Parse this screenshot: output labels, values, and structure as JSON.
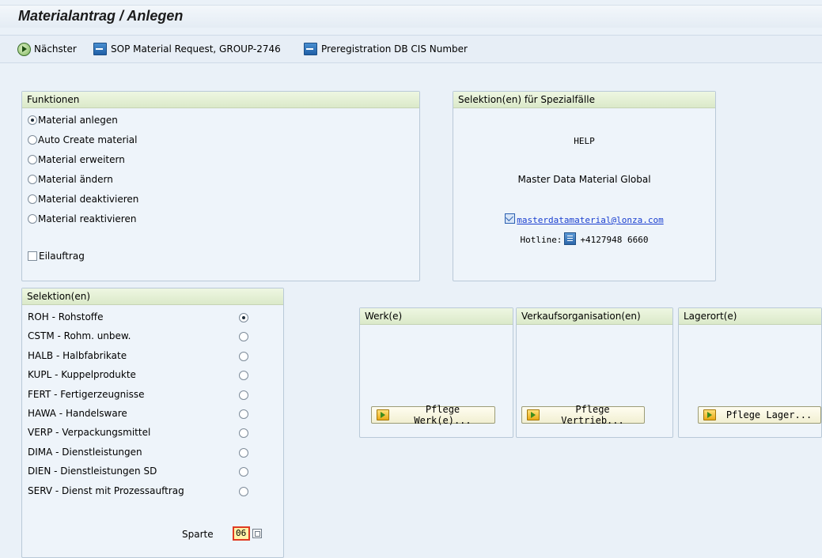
{
  "title": "Materialantrag / Anlegen",
  "toolbar": {
    "next": "Nächster",
    "sop": "SOP Material Request, GROUP-2746",
    "prereg": "Preregistration DB CIS Number"
  },
  "funktionen": {
    "header": "Funktionen",
    "options": [
      {
        "label": "Material anlegen",
        "selected": true
      },
      {
        "label": "Auto Create material",
        "selected": false
      },
      {
        "label": "Material erweitern",
        "selected": false
      },
      {
        "label": "Material ändern",
        "selected": false
      },
      {
        "label": "Material deaktivieren",
        "selected": false
      },
      {
        "label": "Material reaktivieren",
        "selected": false
      }
    ],
    "eilauftrag": {
      "label": "Eilauftrag",
      "checked": false
    }
  },
  "spezial": {
    "header": "Selektion(en) für Spezialfälle",
    "help": "HELP",
    "team": "Master Data Material Global",
    "email": "masterdatamaterial@lonza.com",
    "hotline_label": "Hotline:",
    "hotline_number": "+4127948 6660"
  },
  "selektion": {
    "header": "Selektion(en)",
    "options": [
      {
        "label": "ROH - Rohstoffe",
        "selected": true
      },
      {
        "label": "CSTM - Rohm. unbew.",
        "selected": false
      },
      {
        "label": "HALB - Halbfabrikate",
        "selected": false
      },
      {
        "label": "KUPL - Kuppelprodukte",
        "selected": false
      },
      {
        "label": "FERT - Fertigerzeugnisse",
        "selected": false
      },
      {
        "label": "HAWA - Handelsware",
        "selected": false
      },
      {
        "label": "VERP - Verpackungsmittel",
        "selected": false
      },
      {
        "label": "DIMA - Dienstleistungen",
        "selected": false
      },
      {
        "label": "DIEN - Dienstleistungen SD",
        "selected": false
      },
      {
        "label": "SERV - Dienst mit Prozessauftrag",
        "selected": false
      }
    ],
    "sparte_label": "Sparte",
    "sparte_value": "06"
  },
  "werk": {
    "header": "Werk(e)",
    "button": "Pflege Werk(e)..."
  },
  "vkorg": {
    "header": "Verkaufsorganisation(en)",
    "button": "Pflege Vertrieb..."
  },
  "lagerort": {
    "header": "Lagerort(e)",
    "button": "Pflege Lager..."
  }
}
